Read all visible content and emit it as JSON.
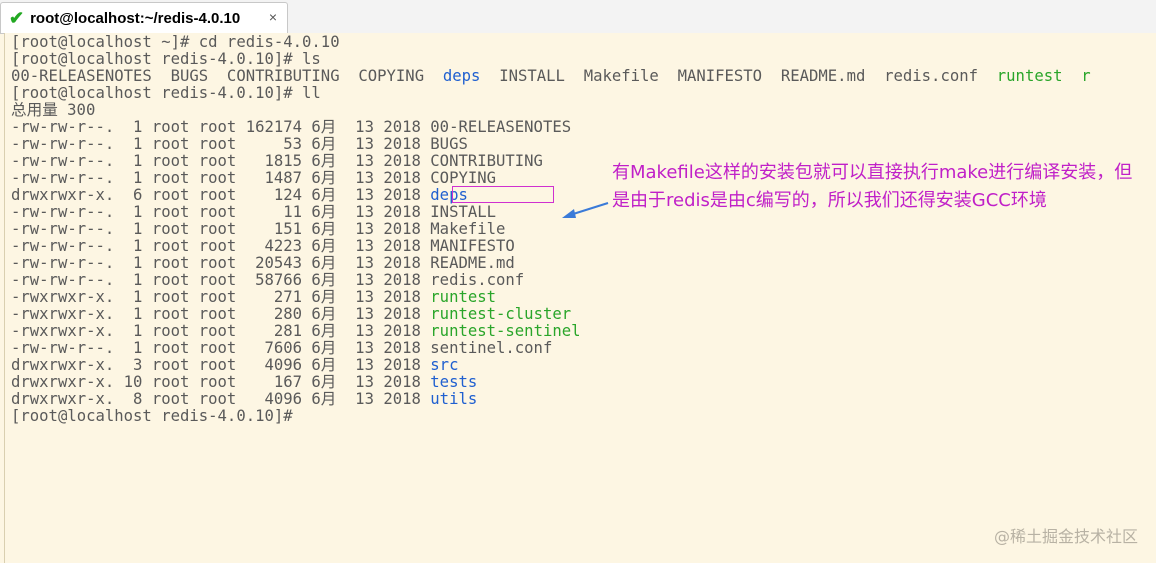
{
  "tab": {
    "title": "root@localhost:~/redis-4.0.10",
    "close_glyph": "×"
  },
  "terminal": {
    "lines": [
      {
        "segments": [
          {
            "text": "[root@localhost ~]# cd redis-4.0.10",
            "cls": ""
          }
        ]
      },
      {
        "segments": [
          {
            "text": "[root@localhost redis-4.0.10]# ls",
            "cls": ""
          }
        ]
      },
      {
        "segments": [
          {
            "text": "00-RELEASENOTES  BUGS  CONTRIBUTING  COPYING  ",
            "cls": ""
          },
          {
            "text": "deps",
            "cls": "blue"
          },
          {
            "text": "  INSTALL  Makefile  MANIFESTO  README.md  redis.conf  ",
            "cls": ""
          },
          {
            "text": "runtest",
            "cls": "green"
          },
          {
            "text": "  r",
            "cls": "green"
          }
        ]
      },
      {
        "segments": [
          {
            "text": "[root@localhost redis-4.0.10]# ll",
            "cls": ""
          }
        ]
      },
      {
        "segments": [
          {
            "text": "总用量 300",
            "cls": ""
          }
        ]
      },
      {
        "segments": [
          {
            "text": "-rw-rw-r--.  1 root root 162174 6月  13 2018 00-RELEASENOTES",
            "cls": ""
          }
        ]
      },
      {
        "segments": [
          {
            "text": "-rw-rw-r--.  1 root root     53 6月  13 2018 BUGS",
            "cls": ""
          }
        ]
      },
      {
        "segments": [
          {
            "text": "-rw-rw-r--.  1 root root   1815 6月  13 2018 CONTRIBUTING",
            "cls": ""
          }
        ]
      },
      {
        "segments": [
          {
            "text": "-rw-rw-r--.  1 root root   1487 6月  13 2018 COPYING",
            "cls": ""
          }
        ]
      },
      {
        "segments": [
          {
            "text": "drwxrwxr-x.  6 root root    124 6月  13 2018 ",
            "cls": ""
          },
          {
            "text": "deps",
            "cls": "blue"
          }
        ]
      },
      {
        "segments": [
          {
            "text": "-rw-rw-r--.  1 root root     11 6月  13 2018 INSTALL",
            "cls": ""
          }
        ]
      },
      {
        "segments": [
          {
            "text": "-rw-rw-r--.  1 root root    151 6月  13 2018 Makefile",
            "cls": ""
          }
        ]
      },
      {
        "segments": [
          {
            "text": "-rw-rw-r--.  1 root root   4223 6月  13 2018 MANIFESTO",
            "cls": ""
          }
        ]
      },
      {
        "segments": [
          {
            "text": "-rw-rw-r--.  1 root root  20543 6月  13 2018 README.md",
            "cls": ""
          }
        ]
      },
      {
        "segments": [
          {
            "text": "-rw-rw-r--.  1 root root  58766 6月  13 2018 redis.conf",
            "cls": ""
          }
        ]
      },
      {
        "segments": [
          {
            "text": "-rwxrwxr-x.  1 root root    271 6月  13 2018 ",
            "cls": ""
          },
          {
            "text": "runtest",
            "cls": "green"
          }
        ]
      },
      {
        "segments": [
          {
            "text": "-rwxrwxr-x.  1 root root    280 6月  13 2018 ",
            "cls": ""
          },
          {
            "text": "runtest-cluster",
            "cls": "green"
          }
        ]
      },
      {
        "segments": [
          {
            "text": "-rwxrwxr-x.  1 root root    281 6月  13 2018 ",
            "cls": ""
          },
          {
            "text": "runtest-sentinel",
            "cls": "green"
          }
        ]
      },
      {
        "segments": [
          {
            "text": "-rw-rw-r--.  1 root root   7606 6月  13 2018 sentinel.conf",
            "cls": ""
          }
        ]
      },
      {
        "segments": [
          {
            "text": "drwxrwxr-x.  3 root root   4096 6月  13 2018 ",
            "cls": ""
          },
          {
            "text": "src",
            "cls": "blue"
          }
        ]
      },
      {
        "segments": [
          {
            "text": "drwxrwxr-x. 10 root root    167 6月  13 2018 ",
            "cls": ""
          },
          {
            "text": "tests",
            "cls": "blue"
          }
        ]
      },
      {
        "segments": [
          {
            "text": "drwxrwxr-x.  8 root root   4096 6月  13 2018 ",
            "cls": ""
          },
          {
            "text": "utils",
            "cls": "blue"
          }
        ]
      },
      {
        "segments": [
          {
            "text": "[root@localhost redis-4.0.10]#",
            "cls": ""
          }
        ]
      }
    ]
  },
  "annotation": {
    "text": "有Makefile这样的安装包就可以直接执行make进行编译安装，但是由于redis是由c编写的，所以我们还得安装GCC环境"
  },
  "watermark": "@稀土掘金技术社区",
  "colors": {
    "background": "#fdf6e3",
    "text": "#5a5a5a",
    "directory": "#2060d0",
    "executable": "#2aa52a",
    "annotation": "#c020c8",
    "arrow": "#3a7ad8"
  }
}
